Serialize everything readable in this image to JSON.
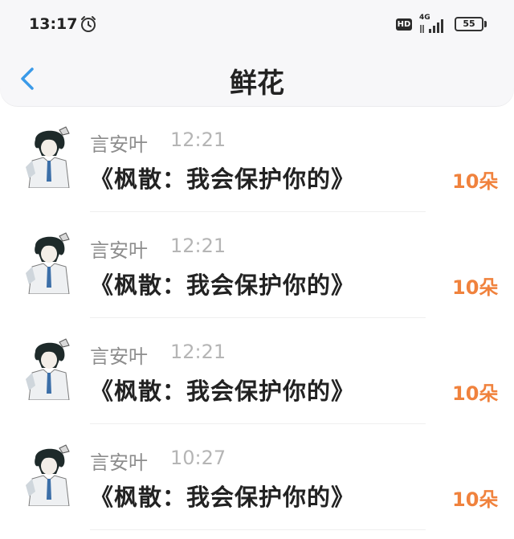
{
  "status_bar": {
    "time": "13:17",
    "alarm_icon": "alarm-clock-icon",
    "hd_label": "HD",
    "network_label": "4G",
    "battery": "55"
  },
  "header": {
    "title": "鲜花",
    "back_icon": "chevron-left-icon"
  },
  "colors": {
    "accent_back": "#3a9ae8",
    "count_orange": "#f0823d"
  },
  "records": [
    {
      "name": "言安叶",
      "time": "12:21",
      "gift": "《枫散：我会保护你的》",
      "count": "10朵"
    },
    {
      "name": "言安叶",
      "time": "12:21",
      "gift": "《枫散：我会保护你的》",
      "count": "10朵"
    },
    {
      "name": "言安叶",
      "time": "12:21",
      "gift": "《枫散：我会保护你的》",
      "count": "10朵"
    },
    {
      "name": "言安叶",
      "time": "10:27",
      "gift": "《枫散：我会保护你的》",
      "count": "10朵"
    }
  ]
}
